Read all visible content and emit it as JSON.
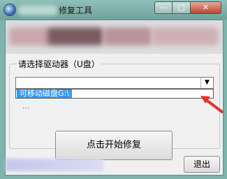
{
  "window": {
    "title": "修复工具"
  },
  "caption": {
    "minimize": "—",
    "maximize": "□",
    "close": "✕"
  },
  "drive_group": {
    "label": "请选择驱动器（U盘）"
  },
  "drive_combo": {
    "selected": "",
    "arrow": "▼"
  },
  "dropdown": {
    "items": [
      "可移动磁盘G:\\"
    ]
  },
  "hidden_text": "...",
  "buttons": {
    "start": "点击开始修复",
    "exit": "退出"
  },
  "colors": {
    "highlight": "#3399ff",
    "annotation_arrow": "#e0352b"
  }
}
